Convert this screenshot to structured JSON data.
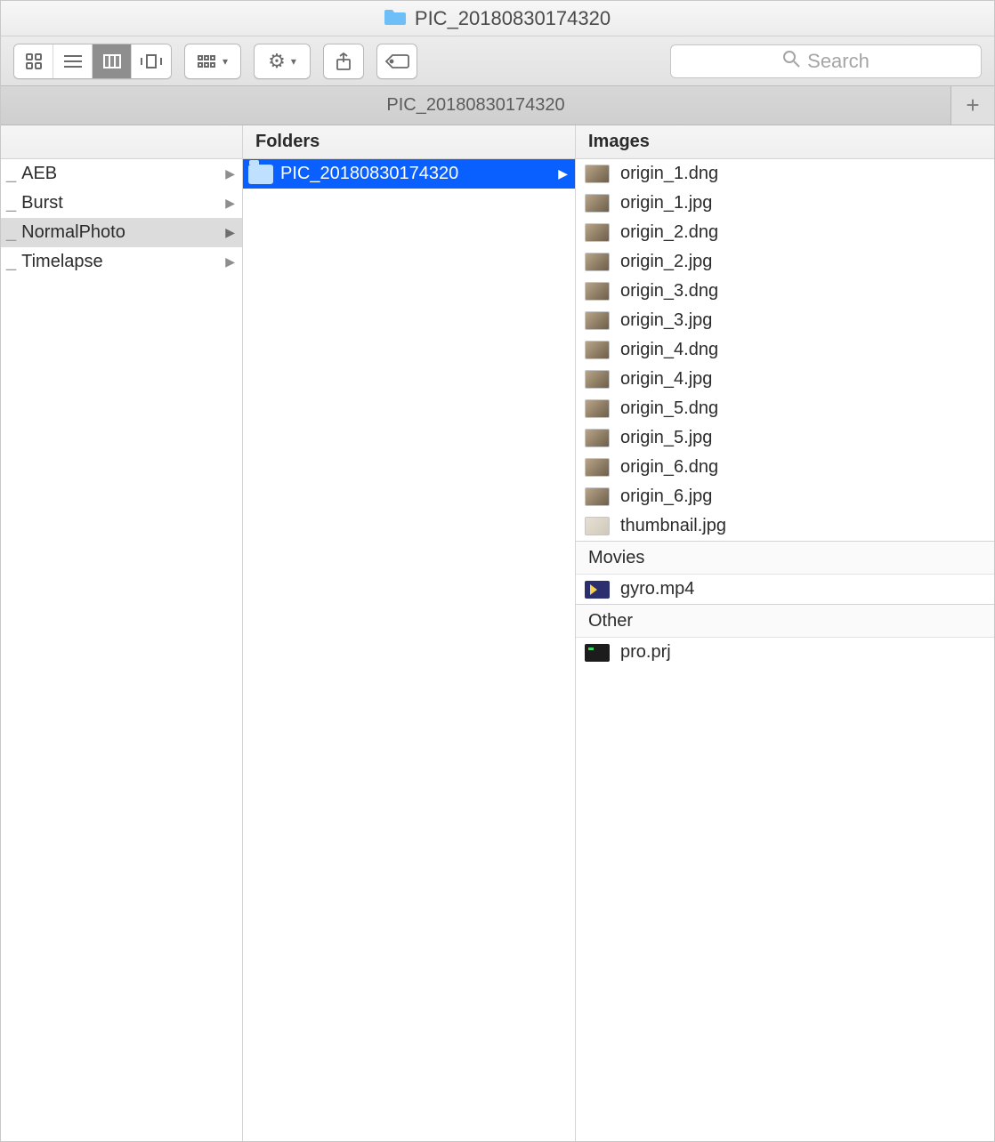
{
  "window": {
    "title": "PIC_20180830174320"
  },
  "toolbar": {
    "view_modes": {
      "icon": "icon-view",
      "list": "list-view",
      "column": "column-view",
      "gallery": "gallery-view",
      "active": "column"
    },
    "arrange": "arrange-by",
    "action": "action-menu",
    "share": "share",
    "tags": "edit-tags",
    "search_placeholder": "Search"
  },
  "tabs": {
    "items": [
      {
        "label": "PIC_20180830174320"
      }
    ],
    "new_tab": "+"
  },
  "columns": {
    "headers": {
      "col1": "",
      "col2": "Folders",
      "col3": "Images"
    },
    "col1": [
      {
        "label": "AEB",
        "has_children": true,
        "selected": false
      },
      {
        "label": "Burst",
        "has_children": true,
        "selected": false
      },
      {
        "label": "NormalPhoto",
        "has_children": true,
        "selected": true
      },
      {
        "label": "Timelapse",
        "has_children": true,
        "selected": false
      }
    ],
    "col2": [
      {
        "label": "PIC_20180830174320",
        "has_children": true,
        "selected": true
      }
    ],
    "col3_groups": [
      {
        "name": "Images",
        "items": [
          {
            "label": "origin_1.dng",
            "kind": "image"
          },
          {
            "label": "origin_1.jpg",
            "kind": "image"
          },
          {
            "label": "origin_2.dng",
            "kind": "image"
          },
          {
            "label": "origin_2.jpg",
            "kind": "image"
          },
          {
            "label": "origin_3.dng",
            "kind": "image"
          },
          {
            "label": "origin_3.jpg",
            "kind": "image"
          },
          {
            "label": "origin_4.dng",
            "kind": "image"
          },
          {
            "label": "origin_4.jpg",
            "kind": "image"
          },
          {
            "label": "origin_5.dng",
            "kind": "image"
          },
          {
            "label": "origin_5.jpg",
            "kind": "image"
          },
          {
            "label": "origin_6.dng",
            "kind": "image"
          },
          {
            "label": "origin_6.jpg",
            "kind": "image"
          },
          {
            "label": "thumbnail.jpg",
            "kind": "image-light"
          }
        ]
      },
      {
        "name": "Movies",
        "items": [
          {
            "label": "gyro.mp4",
            "kind": "movie"
          }
        ]
      },
      {
        "name": "Other",
        "items": [
          {
            "label": "pro.prj",
            "kind": "other"
          }
        ]
      }
    ]
  }
}
